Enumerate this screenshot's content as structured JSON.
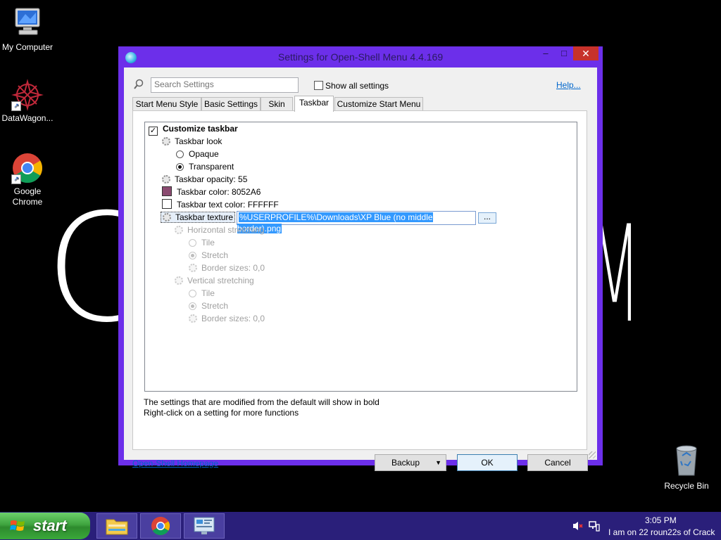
{
  "desktop": {
    "wallpaper_letters": [
      "C",
      "M"
    ],
    "icons": [
      {
        "name": "my-computer",
        "label": "My Computer"
      },
      {
        "name": "datawagon",
        "label": "DataWagon..."
      },
      {
        "name": "google-chrome",
        "label": "Google Chrome"
      },
      {
        "name": "recycle-bin",
        "label": "Recycle Bin"
      }
    ]
  },
  "window": {
    "title": "Settings for Open-Shell Menu 4.4.169",
    "controls": {
      "minimize": "–",
      "maximize": "□",
      "close": "✕"
    },
    "search": {
      "placeholder": "Search Settings",
      "value": ""
    },
    "show_all_label": "Show all settings",
    "show_all_checked": false,
    "help_link": "Help...",
    "tabs": [
      {
        "label": "Start Menu Style"
      },
      {
        "label": "Basic Settings"
      },
      {
        "label": "Skin"
      },
      {
        "label": "Taskbar",
        "active": true
      },
      {
        "label": "Customize Start Menu"
      }
    ],
    "tree": {
      "customize_taskbar": "Customize taskbar",
      "taskbar_look": "Taskbar look",
      "opaque": "Opaque",
      "transparent": "Transparent",
      "opacity": "Taskbar opacity: 55",
      "color": "Taskbar color: 8052A6",
      "color_hex": "#8A4A70",
      "text_color": "Taskbar text color: FFFFFF",
      "text_color_hex": "#FFFFFF",
      "texture_label": "Taskbar texture",
      "texture_value": "%USERPROFILE%\\Downloads\\XP Blue (no middle border).png",
      "browse": "...",
      "h_stretch": "Horizontal stretching",
      "h_tile": "Tile",
      "h_stretch_opt": "Stretch",
      "h_border": "Border sizes: 0,0",
      "v_stretch": "Vertical stretching",
      "v_tile": "Tile",
      "v_stretch_opt": "Stretch",
      "v_border": "Border sizes: 0,0"
    },
    "note_1": "The settings that are modified from the default will show in bold",
    "note_2": "Right-click on a setting for more functions",
    "homepage_link": "Open-Shell Homepage",
    "buttons": {
      "backup": "Backup",
      "ok": "OK",
      "cancel": "Cancel"
    }
  },
  "taskbar": {
    "start_label": "start",
    "pinned": [
      "file-explorer",
      "google-chrome",
      "control-panel"
    ],
    "time": "3:05 PM",
    "status_text": "I am on 22 roun22s of Crack"
  },
  "colors": {
    "window_frame": "#6C2FEA",
    "taskbar": "#2A1F7A",
    "start_green": "#3FA43F",
    "close_red": "#C7322B",
    "link_blue": "#0066CC"
  }
}
